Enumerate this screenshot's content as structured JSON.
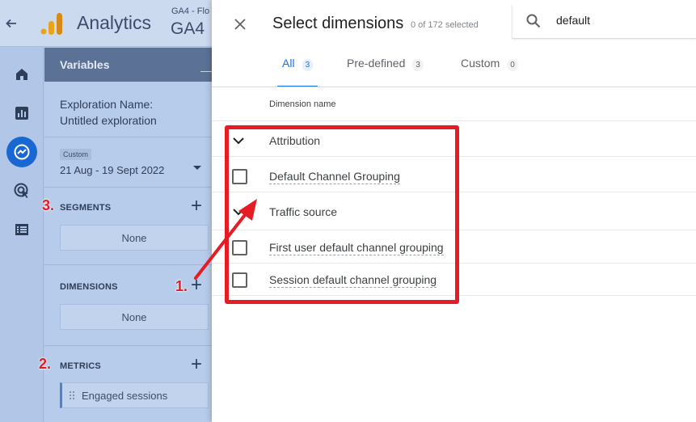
{
  "app": {
    "title": "Analytics",
    "property_small": "GA4 - Flo",
    "property_big": "GA4",
    "brand_color": "#f9ab00"
  },
  "nav": {
    "icons": [
      "home-icon",
      "reports-icon",
      "explore-icon",
      "advertising-icon",
      "configure-icon"
    ],
    "active": "explore-icon"
  },
  "variables": {
    "header": "Variables",
    "exploration_label": "Exploration Name:",
    "exploration_value": "Untitled exploration",
    "date_badge": "Custom",
    "date_value": "21 Aug - 19 Sept 2022",
    "segments_title": "SEGMENTS",
    "segments_value": "None",
    "dimensions_title": "DIMENSIONS",
    "dimensions_value": "None",
    "metrics_title": "METRICS",
    "metric_chip": "Engaged sessions"
  },
  "dialog": {
    "title": "Select dimensions",
    "selected_count": "0 of 172 selected",
    "search_value": "default",
    "tabs": [
      {
        "label": "All",
        "count": "3"
      },
      {
        "label": "Pre-defined",
        "count": "3"
      },
      {
        "label": "Custom",
        "count": "0"
      }
    ],
    "active_tab": "All",
    "column_header": "Dimension name",
    "groups": [
      {
        "label": "Attribution",
        "items": [
          "Default Channel Grouping"
        ]
      },
      {
        "label": "Traffic source",
        "items": [
          "First user default channel grouping",
          "Session default channel grouping"
        ]
      }
    ]
  },
  "annotations": {
    "step1": "1.",
    "step2": "2.",
    "step3": "3.",
    "color": "#e51c24"
  }
}
